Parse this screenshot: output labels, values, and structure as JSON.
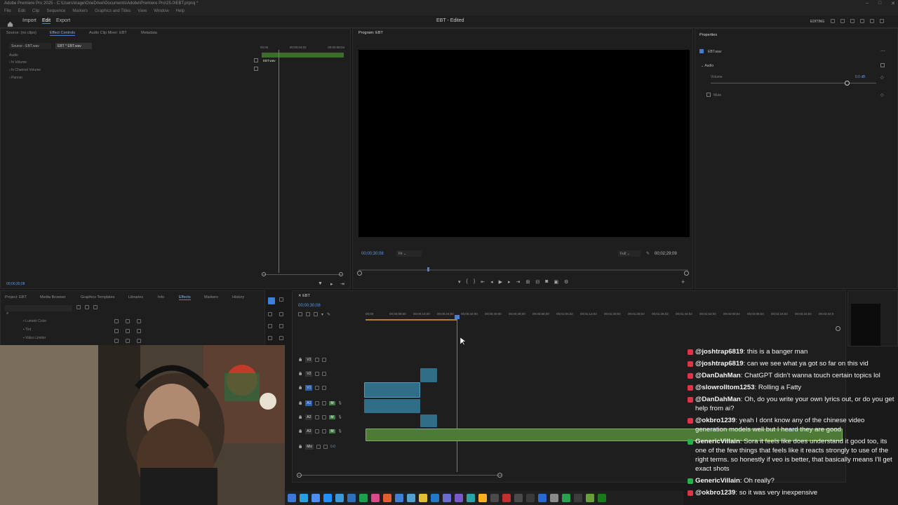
{
  "window": {
    "title": "Adobe Premiere Pro 2025 - C:\\Users\\inage\\OneDrive\\Documents\\Adobe\\Premiere Pro\\25.0\\EBT.prproj *",
    "menu": [
      "File",
      "Edit",
      "Clip",
      "Sequence",
      "Markers",
      "Graphics and Titles",
      "View",
      "Window",
      "Help"
    ]
  },
  "header": {
    "tabs": [
      "Import",
      "Edit",
      "Export"
    ],
    "active_tab": "Edit",
    "project_title": "EBT - Edited",
    "workspace_label": "EDITING"
  },
  "source_panel": {
    "tabs": [
      "Source: (no clips)",
      "Effect Controls",
      "Audio Clip Mixer: EBT",
      "Metadata"
    ],
    "source_tabs": [
      "Source - EBT.wav",
      "EBT * EBT.wav"
    ],
    "section_audio": "Audio",
    "effects": [
      "Volume",
      "Channel Volume",
      "Panner"
    ],
    "ruler_times": [
      "00:00",
      "00:00:04:02",
      "00:00:08:04"
    ],
    "clip_label": "EBT.wav",
    "timecode": "00;00;30;08"
  },
  "program_monitor": {
    "title": "Program: EBT",
    "timecode": "00;00;30;08",
    "fit": "Fit",
    "quality": "Full",
    "duration": "00;02;29;09"
  },
  "properties": {
    "title": "Properties",
    "file": "EBT.wav",
    "section": "Audio",
    "volume_label": "Volume",
    "volume_value": "0.0 dB",
    "volume_level": 0.82,
    "mute_label": "Mute"
  },
  "bottom_left": {
    "tabs": [
      "Project: EBT",
      "Media Browser",
      "Graphics Templates",
      "Libraries",
      "Info",
      "Effects",
      "Markers",
      "History"
    ],
    "active_tab": "Effects",
    "items": [
      "Lumetri Color",
      "Tint",
      "Video Limiter"
    ]
  },
  "timeline": {
    "sequence_tab": "EBT",
    "timecode": "00;00;30;08",
    "ruler_times": [
      "00;00",
      "00;00;08;00",
      "00;00;16;00",
      "00;00;24;00",
      "00;00;32;00",
      "00;00;40;00",
      "00;00;48;00",
      "00;00;56;00",
      "00;01;04;02",
      "00;01;12;02",
      "00;01;20;02",
      "00;01;28;02",
      "00;01;36;02",
      "00;01;44;02",
      "00;01;52;02",
      "00;02;00;04",
      "00;02;08;04",
      "00;02;16;04",
      "00;02;24;04",
      "00;02;32;0"
    ],
    "tracks": [
      "V3",
      "V2",
      "V1",
      "A1",
      "A2",
      "A3",
      "Mix"
    ],
    "mix_value": "0.0"
  },
  "chat": [
    {
      "user": "@joshtrap6819",
      "text": "this is a banger man",
      "badge": "red"
    },
    {
      "user": "@joshtrap6819",
      "text": "can we see what ya got so far on this vid",
      "badge": "red"
    },
    {
      "user": "@DanDahMan",
      "text": "ChatGPT didn't wanna touch certain topics lol",
      "badge": "red"
    },
    {
      "user": "@slowrolltom1253",
      "text": "Rolling a Fatty",
      "badge": "red"
    },
    {
      "user": "@DanDahMan",
      "text": "Oh, do you write your own lyrics out, or do you get help from ai?",
      "badge": "red"
    },
    {
      "user": "@okbro1239",
      "text": "yeah I dont know any of the chinese video generation models well but I heard they are good",
      "badge": "red"
    },
    {
      "user": "GenericVillain",
      "text": "Sora it feels like does understand it good too, its one of the few things that feels like it reacts strongly to use of the right terms. so honestly if veo is better, that basically means I'll get exact shots",
      "badge": "green"
    },
    {
      "user": "GenericVillain",
      "text": "Oh really?",
      "badge": "green"
    },
    {
      "user": "@okbro1239",
      "text": "so it was very inexpensive",
      "badge": "red"
    }
  ],
  "colors": {
    "accent_blue": "#3f7fd6",
    "audio_green": "#4e7a38",
    "video_clip": "#2f6e86",
    "chat_youtube": "#e0334a",
    "chat_green": "#27b04e"
  }
}
